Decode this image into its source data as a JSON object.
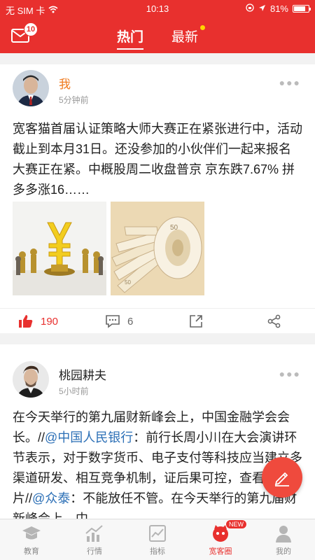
{
  "status_bar": {
    "carrier": "无 SIM 卡",
    "time": "10:13",
    "battery_text": "81%",
    "battery_level": 0.81
  },
  "header": {
    "mail_badge": "10",
    "tabs": [
      {
        "label": "热门",
        "active": true
      },
      {
        "label": "最新",
        "active": false,
        "has_dot": true
      }
    ]
  },
  "posts": [
    {
      "user": "我",
      "time": "5分钟前",
      "text": "宽客猫首届认证策略大师大赛正在紧张进行中，活动截止到本月31日。还没参加的小伙伴们一起来报名大赛正在紧。中概股周二收盘普京 京东跌7.67% 拼多多涨16……",
      "likes": "190",
      "comments": "6"
    },
    {
      "user": "桃园耕夫",
      "time": "5小时前",
      "text_parts": [
        "在今天举行的第九届财新峰会上，中国金融学会会长。//",
        "@中国人民银行",
        "：前行长周小川在大会演讲环节表示，对于数字货币、电子支付等科技应当建立多渠道研发、相互竞争机制，证后果可控，查看图片//",
        "@众泰",
        "：不能放任不管。在今天举行的第九届财新峰会上，中"
      ]
    }
  ],
  "bottom_nav": [
    {
      "label": "教育",
      "icon": "graduation-cap-icon"
    },
    {
      "label": "行情",
      "icon": "chart-icon"
    },
    {
      "label": "指标",
      "icon": "indicator-icon"
    },
    {
      "label": "宽客圈",
      "icon": "cat-icon",
      "active": true,
      "badge": "NEW"
    },
    {
      "label": "我的",
      "icon": "person-icon"
    }
  ],
  "colors": {
    "brand": "#e8302e",
    "link": "#2b6fb6",
    "fab": "#ef4a3d"
  }
}
